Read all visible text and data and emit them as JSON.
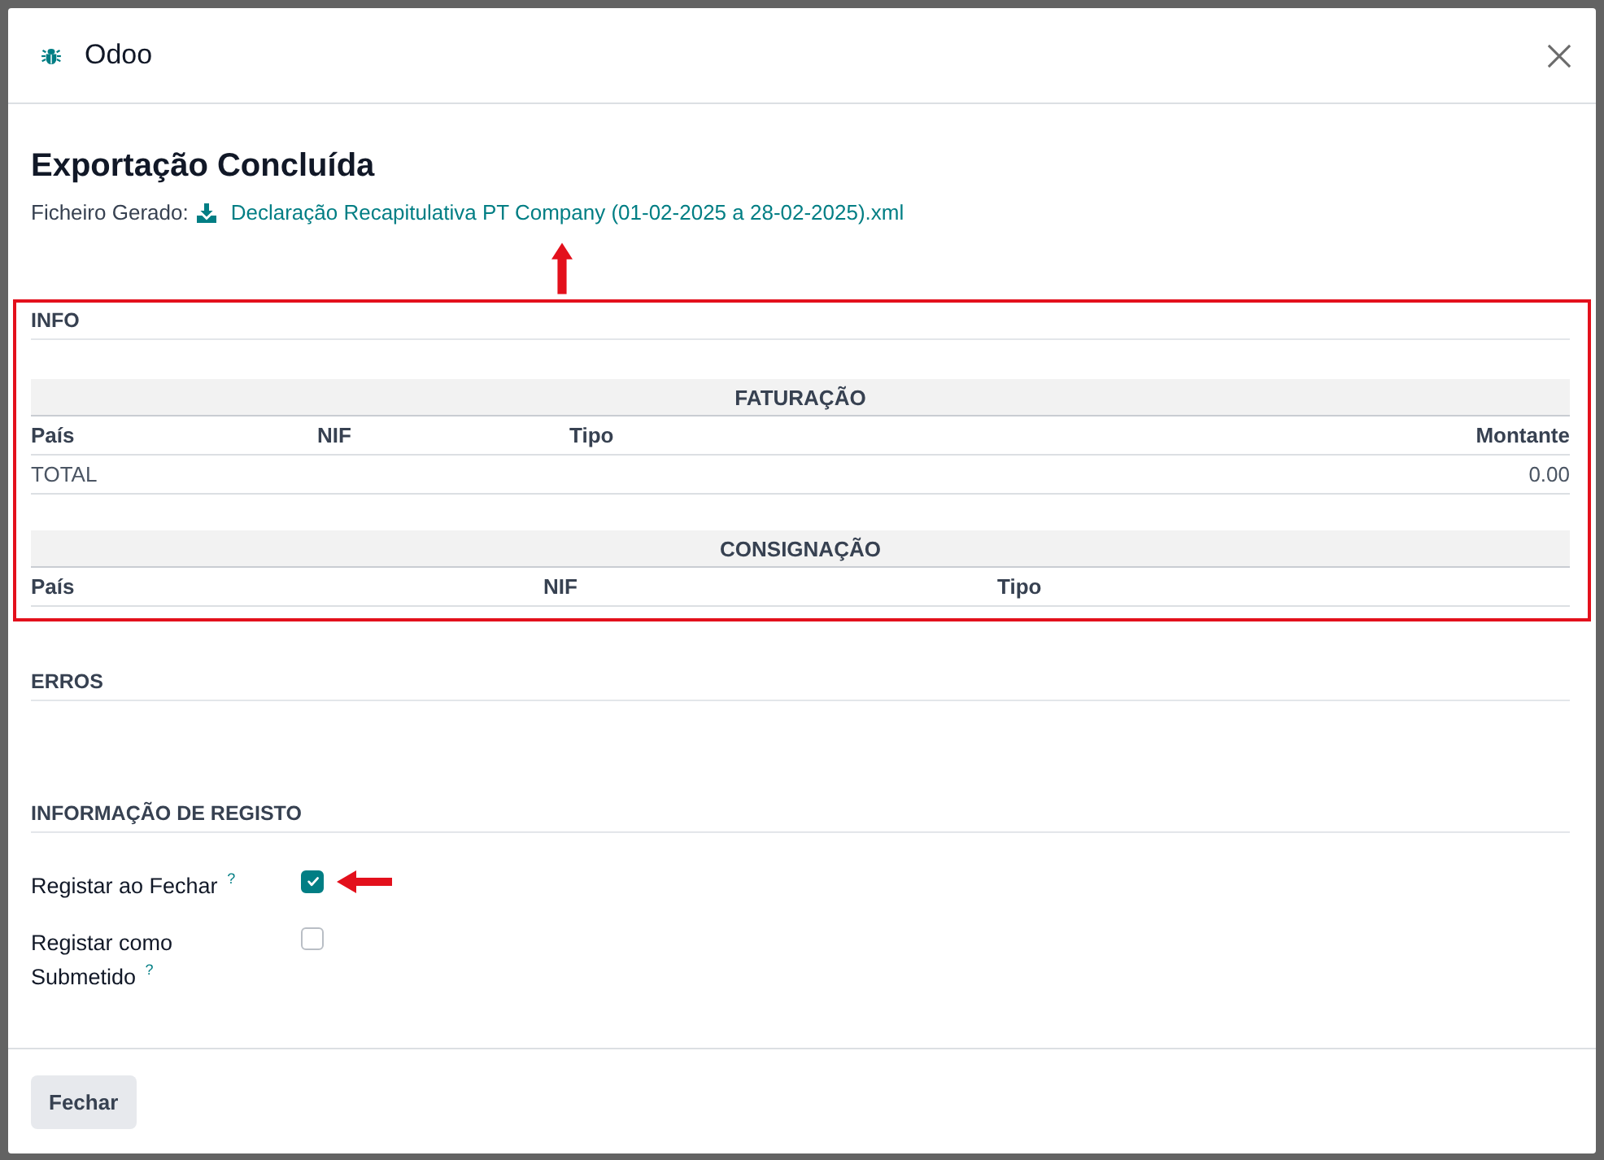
{
  "dialog": {
    "title": "Odoo"
  },
  "heading": "Exportação Concluída",
  "generated_file": {
    "label": "Ficheiro Gerado:",
    "link": "Declaração Recapitulativa PT Company (01-02-2025 a 28-02-2025).xml"
  },
  "info": {
    "title": "INFO",
    "tables": [
      {
        "title": "FATURAÇÃO",
        "columns": [
          {
            "label": "País",
            "kind": "text"
          },
          {
            "label": "NIF",
            "kind": "text"
          },
          {
            "label": "Tipo",
            "kind": "text"
          },
          {
            "label": "Montante",
            "kind": "amount"
          }
        ],
        "total": {
          "label": "TOTAL",
          "amount": "0.00"
        }
      },
      {
        "title": "CONSIGNAÇÃO",
        "columns": [
          {
            "label": "País",
            "kind": "text"
          },
          {
            "label": "NIF",
            "kind": "text"
          },
          {
            "label": "Tipo",
            "kind": "text"
          }
        ]
      }
    ]
  },
  "errors": {
    "title": "ERROS"
  },
  "registration": {
    "title": "INFORMAÇÃO DE REGISTO",
    "fields": [
      {
        "label": "Registar ao Fechar $^{?}$",
        "checked": true
      },
      {
        "label": "Registar como Submetido $^{?}$",
        "checked": false
      }
    ]
  },
  "footer": {
    "buttons": [
      "Fechar"
    ]
  }
}
